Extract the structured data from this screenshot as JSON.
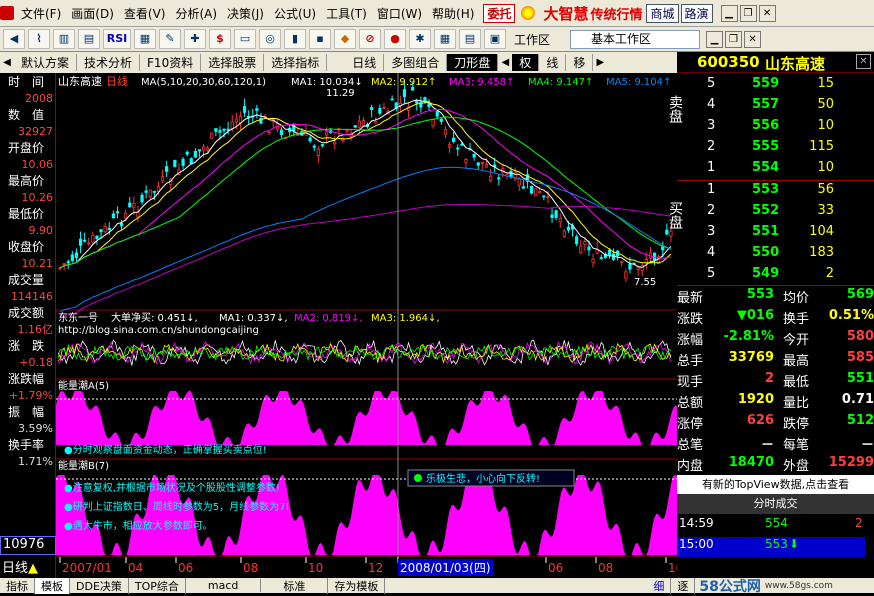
{
  "menu": {
    "items": [
      "文件(F)",
      "画面(D)",
      "查看(V)",
      "分析(A)",
      "决策(J)",
      "公式(U)",
      "工具(T)",
      "窗口(W)",
      "帮助(H)"
    ],
    "entrust": "委托",
    "brand": "大智慧",
    "brand_sub": "传统行情",
    "mall": "商城",
    "road": "路演"
  },
  "toolbar": {
    "rsi": "RSI",
    "workspace_label": "工作区",
    "workspace_value": "基本工作区"
  },
  "tabs": [
    "默认方案",
    "技术分析",
    "F10资料",
    "选择股票",
    "选择指标",
    "日线",
    "多图组合",
    "刀形盘",
    "权",
    "线",
    "移"
  ],
  "stock": {
    "code": "600350",
    "name": "山东高速"
  },
  "left": {
    "items": [
      {
        "label": "时　间",
        "value": "2008"
      },
      {
        "label": "数　值",
        "value": "32927"
      },
      {
        "label": "开盘价",
        "value": "10.06"
      },
      {
        "label": "最高价",
        "value": "10.26"
      },
      {
        "label": "最低价",
        "value": "9.90"
      },
      {
        "label": "收盘价",
        "value": "10.21"
      },
      {
        "label": "成交量",
        "value": "114146"
      },
      {
        "label": "成交额",
        "value": "1.16亿"
      },
      {
        "label": "涨　跌",
        "value": "+0.18"
      },
      {
        "label": "涨跌幅",
        "value": "+1.79%"
      },
      {
        "label": "振　幅",
        "value": "3.59%"
      },
      {
        "label": "换手率",
        "value": "1.71%"
      }
    ],
    "vol_box": "10976",
    "period": "日线"
  },
  "chart": {
    "title_name": "山东高速",
    "title_period": "日线",
    "ma_params": "MA(5,10,20,30,60,120,1)",
    "ma": [
      {
        "label": "MA1: 10.034↓",
        "color": "#ffffff"
      },
      {
        "label": "MA2: 9.912↑",
        "color": "#ffff00"
      },
      {
        "label": "MA3: 9.458↑",
        "color": "#ff00ff"
      },
      {
        "label": "MA4: 9.147↑",
        "color": "#00ff00"
      },
      {
        "label": "MA5: 9.104↑",
        "color": "#0080ff"
      }
    ],
    "high_label": "11.29",
    "low_label": "7.55",
    "ind1_name": "东东一号",
    "ind1_sub": "大单净买: 0.451↓,",
    "ind1_ma": [
      {
        "label": "MA1: 0.337↓,",
        "color": "#ffffff"
      },
      {
        "label": "MA2: 0.819↓,",
        "color": "#ff00ff"
      },
      {
        "label": "MA3: 1.964↓,",
        "color": "#ffff00"
      }
    ],
    "ind1_url": "http://blog.sina.com.cn/shundongcaijing",
    "ind2_name": "能量潮A(5)",
    "ind2_note": "●分时观察盘面资金动态，正确掌握买卖点位!",
    "ind3_name": "能量潮B(7)",
    "ind3_notes": [
      "●注意复权,并根据市场状况及个股股性调整参数!",
      "●研判上证指数日、周线时参数为5，月线参数为7!",
      "●遇大牛市，相应放大参数即可。"
    ],
    "tooltip": "乐极生悲，小心向下反转!",
    "date_axis": [
      "2007/01",
      "04",
      "06",
      "08",
      "10",
      "12",
      "2008/01/03(四)",
      "06",
      "08",
      "10"
    ]
  },
  "book": {
    "sell": [
      {
        "lvl": "5",
        "price": "559",
        "vol": "15"
      },
      {
        "lvl": "4",
        "price": "557",
        "vol": "50"
      },
      {
        "lvl": "3",
        "price": "556",
        "vol": "10"
      },
      {
        "lvl": "2",
        "price": "555",
        "vol": "115"
      },
      {
        "lvl": "1",
        "price": "554",
        "vol": "10"
      }
    ],
    "buy": [
      {
        "lvl": "1",
        "price": "553",
        "vol": "56"
      },
      {
        "lvl": "2",
        "price": "552",
        "vol": "33"
      },
      {
        "lvl": "3",
        "price": "551",
        "vol": "104"
      },
      {
        "lvl": "4",
        "price": "550",
        "vol": "183"
      },
      {
        "lvl": "5",
        "price": "549",
        "vol": "2"
      }
    ],
    "sell_label": "卖盘",
    "buy_label": "买盘",
    "stats": [
      {
        "l1": "最新",
        "v1": "553",
        "c1": "#00ff00",
        "l2": "均价",
        "v2": "569",
        "c2": "#00ff00"
      },
      {
        "l1": "涨跌",
        "v1": "▼016",
        "c1": "#00ff00",
        "l2": "换手",
        "v2": "0.51%",
        "c2": "#ffff00"
      },
      {
        "l1": "涨幅",
        "v1": "-2.81%",
        "c1": "#00ff00",
        "l2": "今开",
        "v2": "580",
        "c2": "#ff4040"
      },
      {
        "l1": "总手",
        "v1": "33769",
        "c1": "#ffff00",
        "l2": "最高",
        "v2": "585",
        "c2": "#ff4040"
      },
      {
        "l1": "现手",
        "v1": "2",
        "c1": "#ff4040",
        "l2": "最低",
        "v2": "551",
        "c2": "#00ff00"
      },
      {
        "l1": "总额",
        "v1": "1920",
        "c1": "#ffff00",
        "l2": "量比",
        "v2": "0.71",
        "c2": "#ffffff"
      },
      {
        "l1": "涨停",
        "v1": "626",
        "c1": "#ff4040",
        "l2": "跌停",
        "v2": "512",
        "c2": "#00ff00"
      },
      {
        "l1": "总笔",
        "v1": "－",
        "c1": "#ffffff",
        "l2": "每笔",
        "v2": "－",
        "c2": "#ffffff"
      },
      {
        "l1": "内盘",
        "v1": "18470",
        "c1": "#00ff00",
        "l2": "外盘",
        "v2": "15299",
        "c2": "#ff4040"
      }
    ],
    "topview": "有新的TopView数据,点击查看",
    "ticks_title": "分时成交",
    "ticks": [
      {
        "time": "14:59",
        "price": "554",
        "vol": "2"
      },
      {
        "time": "15:00",
        "price": "553",
        "vol": ""
      }
    ]
  },
  "status": {
    "items": [
      "指标",
      "模板",
      "DDE决策",
      "TOP综合",
      "macd",
      "标准",
      "存为模板"
    ],
    "right": [
      "细",
      "逐"
    ],
    "watermark": "58公式网",
    "watermark_url": "www.58gs.com"
  }
}
